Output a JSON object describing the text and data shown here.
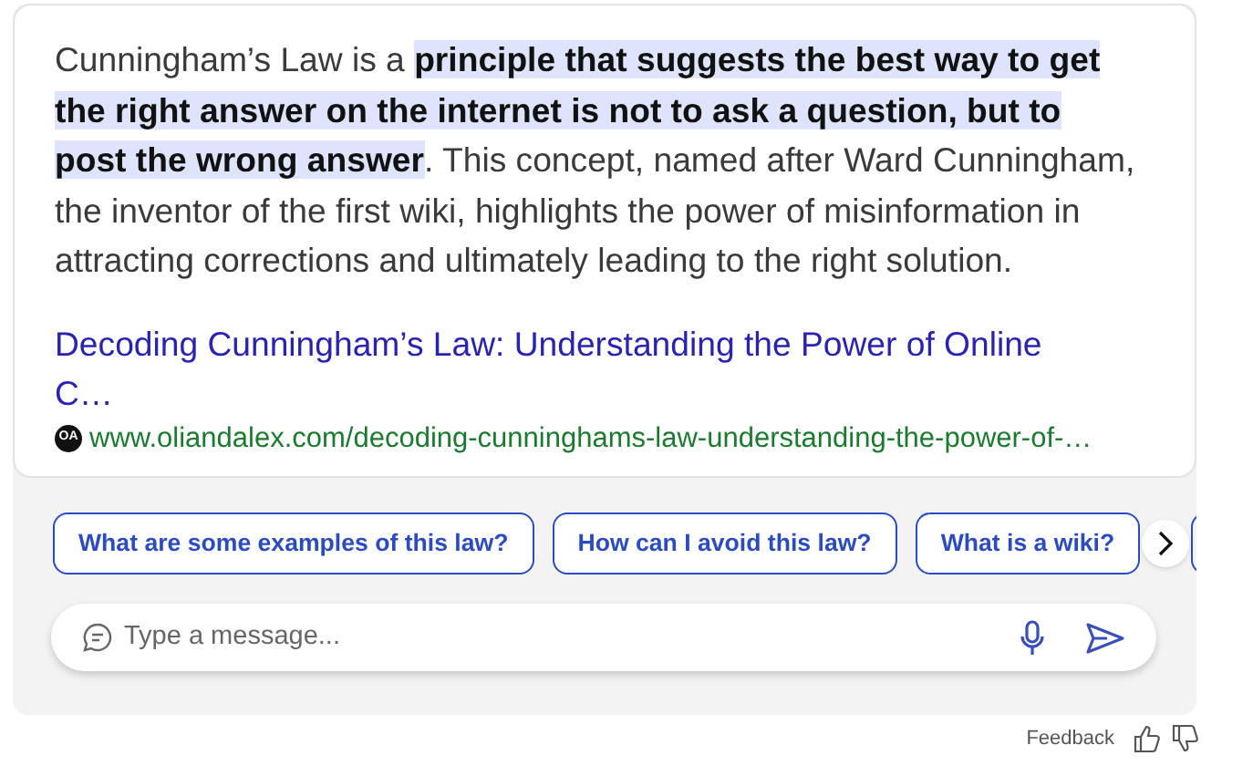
{
  "answer": {
    "paragraph": "Cunningham’s Law is a **principle that suggests the best way to get the right answer on the internet is not to ask a question, but to post the wrong answer**. This concept, named after Ward Cunningham, the inventor of the first wiki, highlights the power of misinformation in attracting corrections and ultimately leading to the right solution.",
    "source": {
      "title": "Decoding Cunningham’s Law: Understanding the Power of Online C…",
      "favicon": "OA",
      "url": "www.oliandalex.com/decoding-cunninghams-law-understanding-the-power-of-…"
    }
  },
  "suggestions": [
    {
      "label": "What are some examples of this law?"
    },
    {
      "label": "How can I avoid this law?"
    },
    {
      "label": "What is a wiki?"
    }
  ],
  "composer": {
    "placeholder": "Type a message..."
  },
  "feedback": {
    "label": "Feedback"
  }
}
